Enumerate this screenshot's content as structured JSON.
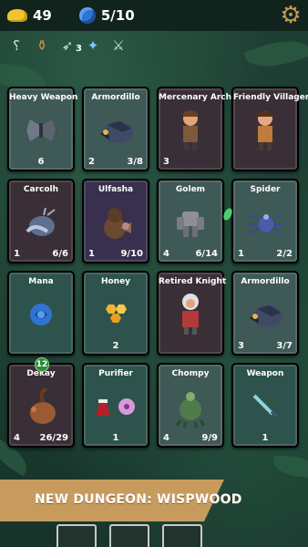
{
  "resources": {
    "gold": "49",
    "mana": "5/10"
  },
  "relic_count": "3",
  "cards": [
    {
      "name": "Heavy Weapon",
      "left": "",
      "center": "6",
      "right": "",
      "style": "c-gray",
      "art": "weapon"
    },
    {
      "name": "Armordillo",
      "left": "2",
      "center": "",
      "right": "3/8",
      "style": "c-gray",
      "art": "armordillo"
    },
    {
      "name": "Mercenary Archer",
      "left": "3",
      "center": "",
      "right": "",
      "style": "c-dark",
      "art": "archer"
    },
    {
      "name": "Friendly Villager",
      "left": "",
      "center": "",
      "right": "",
      "style": "c-dark",
      "art": "villager"
    },
    {
      "name": "Carcolh",
      "left": "1",
      "center": "",
      "right": "6/6",
      "style": "c-dark",
      "art": "carcolh"
    },
    {
      "name": "Ulfasha",
      "left": "1",
      "center": "",
      "right": "9/10",
      "style": "c-purple",
      "art": "ulfasha"
    },
    {
      "name": "Golem",
      "left": "4",
      "center": "",
      "right": "6/14",
      "style": "c-gray",
      "art": "golem"
    },
    {
      "name": "Spider",
      "left": "1",
      "center": "",
      "right": "2/2",
      "style": "c-gray",
      "art": "spider"
    },
    {
      "name": "Mana",
      "left": "",
      "center": "",
      "right": "",
      "style": "c-teal",
      "art": "mana"
    },
    {
      "name": "Honey",
      "left": "",
      "center": "2",
      "right": "",
      "style": "c-teal",
      "art": "honey"
    },
    {
      "name": "Retired Knight",
      "left": "",
      "center": "",
      "right": "",
      "style": "c-dark",
      "art": "knight"
    },
    {
      "name": "Armordillo",
      "left": "3",
      "center": "",
      "right": "3/7",
      "style": "c-gray",
      "art": "armordillo"
    },
    {
      "name": "Dekay",
      "left": "4",
      "center": "",
      "right": "26/29",
      "style": "c-dark",
      "art": "dekay",
      "badge": "12"
    },
    {
      "name": "Purifier",
      "left": "",
      "center": "1",
      "right": "",
      "style": "c-teal",
      "art": "purifier"
    },
    {
      "name": "Chompy",
      "left": "4",
      "center": "",
      "right": "9/9",
      "style": "c-gray",
      "art": "chompy"
    },
    {
      "name": "Weapon",
      "left": "",
      "center": "1",
      "right": "",
      "style": "c-teal",
      "art": "dagger"
    }
  ],
  "banner": "NEW DUNGEON: WISPWOOD"
}
